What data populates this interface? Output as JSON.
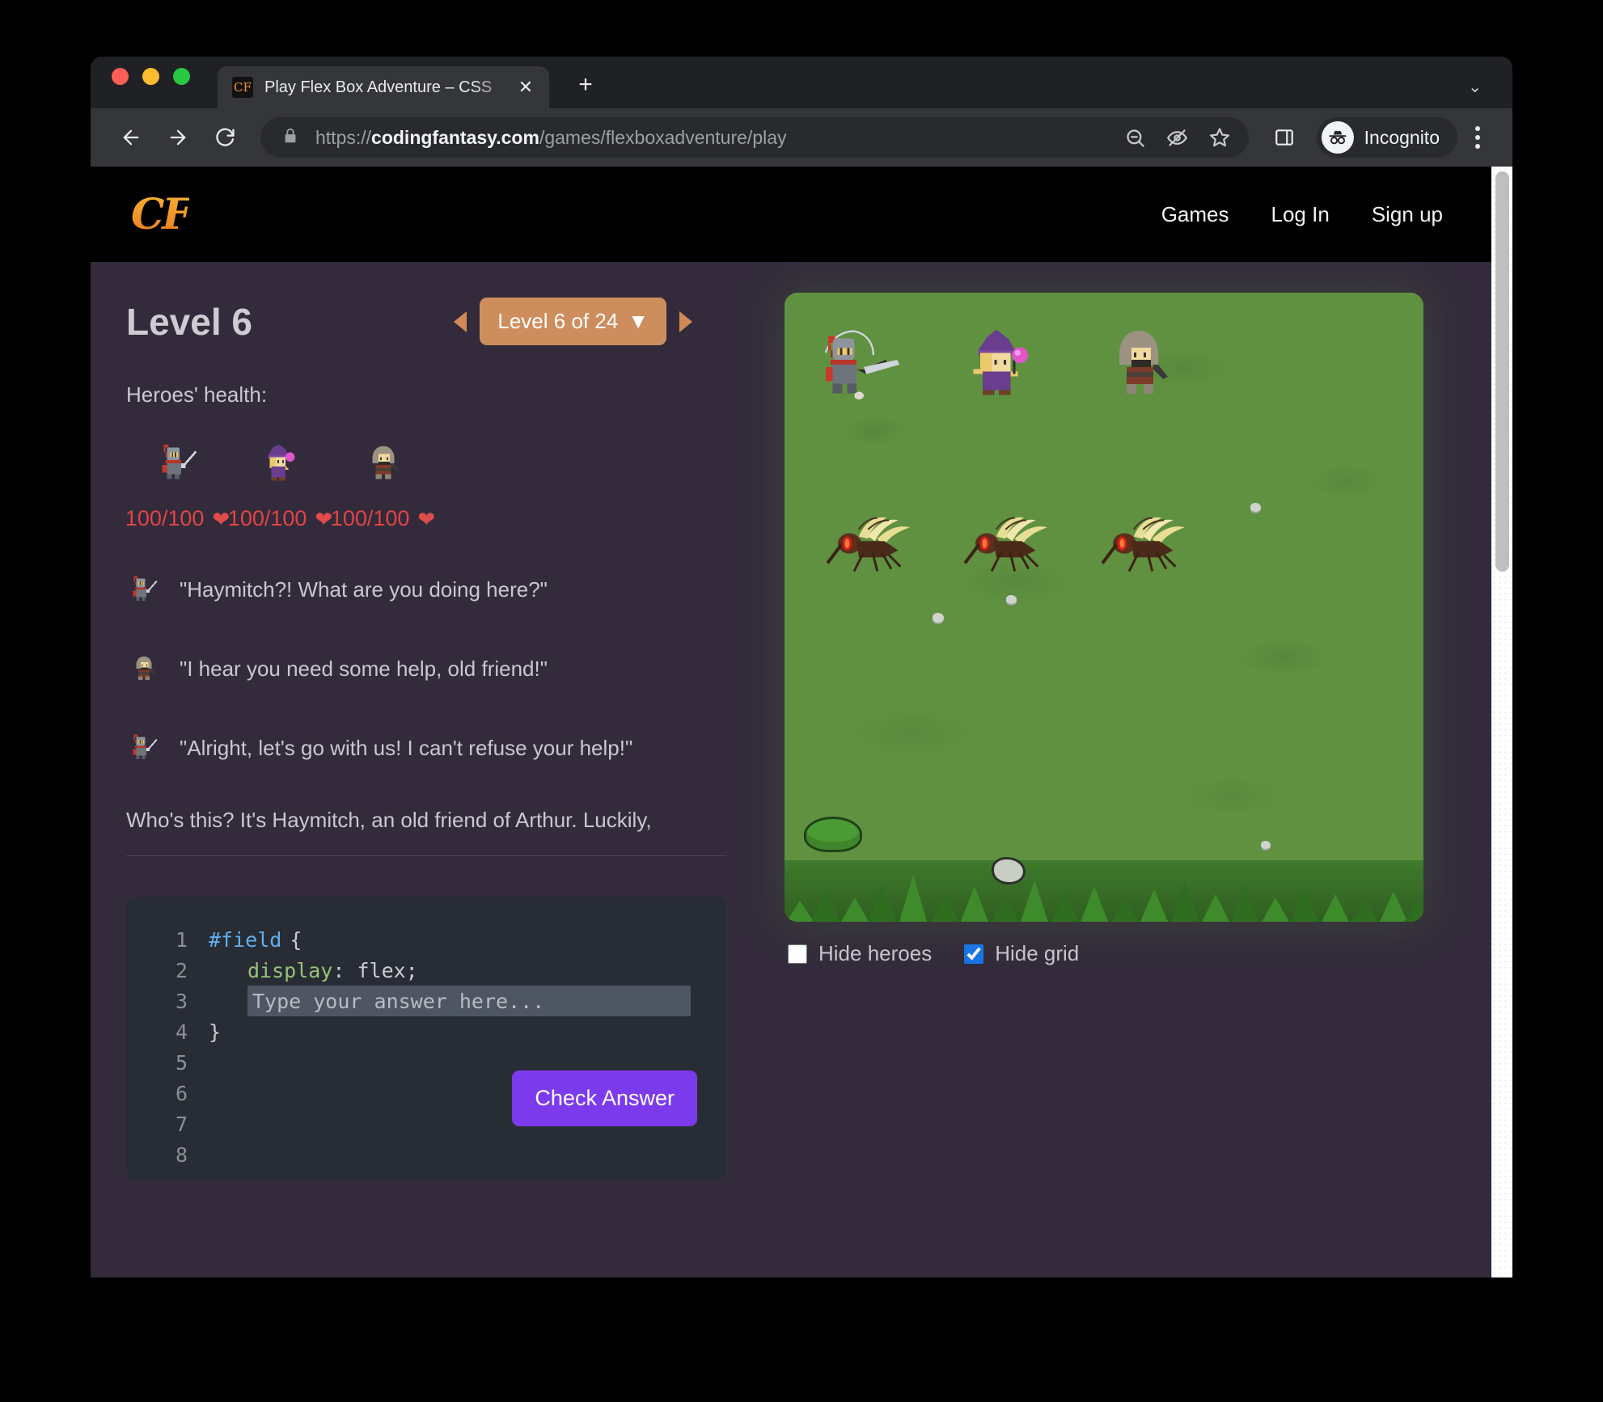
{
  "browser": {
    "tab": {
      "title": "Play Flex Box Adventure – CSS",
      "favicon": "CF",
      "close_icon": "✕"
    },
    "new_tab_icon": "+",
    "tabstrip_chevron_icon": "⌄",
    "nav": {
      "back_icon": "back-arrow",
      "forward_icon": "forward-arrow",
      "reload_icon": "reload"
    },
    "omnibox": {
      "lock_icon": "lock",
      "scheme": "https://",
      "host": "codingfantasy.com",
      "path": "/games/flexboxadventure/play",
      "icons": [
        "zoom-out-icon",
        "eye-off-icon",
        "bookmark-star-icon"
      ]
    },
    "side_panel_icon": "side-panel",
    "profile": {
      "label": "Incognito",
      "icon": "incognito-hat-glasses"
    },
    "menu_icon": "kebab-menu"
  },
  "site": {
    "logo": "CF",
    "nav": [
      {
        "label": "Games"
      },
      {
        "label": "Log In"
      },
      {
        "label": "Sign up"
      }
    ]
  },
  "level": {
    "title": "Level 6",
    "selector_label": "Level 6 of 24",
    "selector_caret": "▼",
    "prev_icon": "prev-level-arrow",
    "next_icon": "next-level-arrow",
    "current": 6,
    "total": 24
  },
  "health": {
    "label": "Heroes' health:",
    "heart_icon": "❤",
    "heroes": [
      {
        "name": "knight",
        "hp": "100/100"
      },
      {
        "name": "wizard",
        "hp": "100/100"
      },
      {
        "name": "rogue",
        "hp": "100/100"
      }
    ]
  },
  "dialogue": [
    {
      "speaker": "knight",
      "text": "\"Haymitch?! What are you doing here?\""
    },
    {
      "speaker": "rogue",
      "text": "\"I hear you need some help, old friend!\""
    },
    {
      "speaker": "knight",
      "text": "\"Alright, let's go with us! I can't refuse your help!\""
    }
  ],
  "story": "Who's this? It's Haymitch, an old friend of Arthur. Luckily,",
  "editor": {
    "line_numbers": [
      "1",
      "2",
      "3",
      "4",
      "5",
      "6",
      "7",
      "8"
    ],
    "line1_selector": "#field",
    "line1_brace": "{",
    "line2_property": "display",
    "line2_value": ": flex;",
    "line4_brace": "}",
    "input_placeholder": "Type your answer here...",
    "input_value": "",
    "check_button": "Check Answer"
  },
  "game": {
    "heroes": [
      "knight",
      "wizard",
      "rogue"
    ],
    "enemies": [
      "mosquito",
      "mosquito",
      "mosquito"
    ],
    "options": [
      {
        "id": "hide-heroes",
        "label": "Hide heroes",
        "checked": false
      },
      {
        "id": "hide-grid",
        "label": "Hide grid",
        "checked": true
      }
    ]
  },
  "colors": {
    "accent_purple": "#7c3aed",
    "level_tan": "#cd8d5c",
    "health_red": "#e14444",
    "field_green": "#5f9140",
    "checkbox_blue": "#1a73e8",
    "logo_orange": "#f0932b"
  }
}
